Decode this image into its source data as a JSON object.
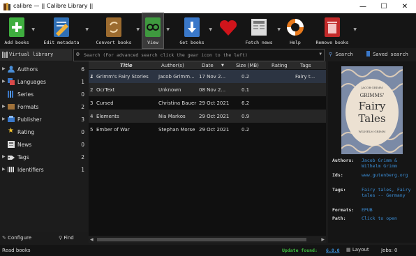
{
  "window": {
    "title": "calibre — || Calibre Library ||",
    "minimize": "—",
    "maximize": "☐",
    "close": "✕"
  },
  "toolbar": {
    "add_books": "Add books",
    "edit_metadata": "Edit metadata",
    "convert_books": "Convert books",
    "view": "View",
    "get_books": "Get books",
    "fetch_news": "Fetch news",
    "help": "Help",
    "remove_books": "Remove books"
  },
  "virtual_library": "Virtual library",
  "search": {
    "placeholder": "Search (For advanced search click the gear icon to the left)",
    "search_label": "Search",
    "saved_search_label": "Saved search"
  },
  "sidebar": {
    "items": [
      {
        "label": "Authors",
        "count": "6"
      },
      {
        "label": "Languages",
        "count": "1"
      },
      {
        "label": "Series",
        "count": "0"
      },
      {
        "label": "Formats",
        "count": "2"
      },
      {
        "label": "Publisher",
        "count": "3"
      },
      {
        "label": "Rating",
        "count": "0"
      },
      {
        "label": "News",
        "count": "0"
      },
      {
        "label": "Tags",
        "count": "2"
      },
      {
        "label": "Identifiers",
        "count": "1"
      }
    ],
    "configure": "Configure",
    "find": "Find"
  },
  "table": {
    "headers": [
      "Title",
      "Author(s)",
      "Date",
      "Size (MB)",
      "Rating",
      "Tags"
    ],
    "rows": [
      {
        "num": "1",
        "title": "Grimm's Fairy Stories",
        "author": "Jacob Grimm...",
        "date": "17 Nov 2...",
        "size": "0.2",
        "rating": "",
        "tags": "Fairy t..."
      },
      {
        "num": "2",
        "title": "OcrText",
        "author": "Unknown",
        "date": "08 Nov 2...",
        "size": "0.1",
        "rating": "",
        "tags": ""
      },
      {
        "num": "3",
        "title": "Cursed",
        "author": "Christina Bauer",
        "date": "29 Oct 2021",
        "size": "6.2",
        "rating": "",
        "tags": ""
      },
      {
        "num": "4",
        "title": "Elements",
        "author": "Nia Markos",
        "date": "29 Oct 2021",
        "size": "0.9",
        "rating": "",
        "tags": ""
      },
      {
        "num": "5",
        "title": "Ember of War",
        "author": "Stephan Morse",
        "date": "29 Oct 2021",
        "size": "0.2",
        "rating": "",
        "tags": ""
      }
    ]
  },
  "cover": {
    "author_top": "JACOB GRIMM",
    "title_line1": "GRIMMS'",
    "title_line2": "Fairy",
    "title_line3": "Tales",
    "author_bottom": "WILHELM GRIMM"
  },
  "details": {
    "authors_key": "Authors:",
    "authors_val": "Jacob Grimm & Wilhelm Grimm",
    "ids_key": "Ids:",
    "ids_val": "www.gutenberg.org",
    "tags_key": "Tags:",
    "tags_val": "Fairy tales, Fairy tales -- Germany",
    "formats_key": "Formats:",
    "formats_val": "EPUB",
    "path_key": "Path:",
    "path_val": "Click to open"
  },
  "status": {
    "left": "Read books",
    "update_label": "Update found:",
    "update_version": "6.8.0",
    "layout": "Layout",
    "jobs": "Jobs: 0"
  },
  "colors": {
    "accent_link": "#3b8fd9",
    "update_green": "#3fbf3f"
  }
}
